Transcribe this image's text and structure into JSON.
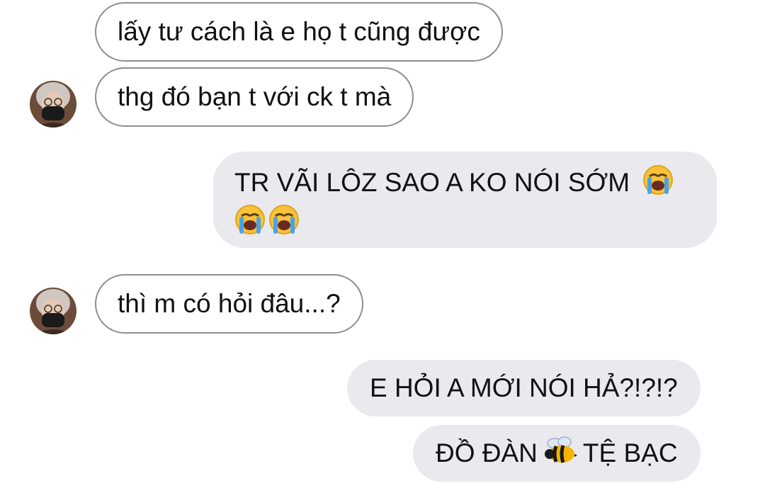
{
  "messages": [
    {
      "side": "incoming",
      "text": "lấy tư cách là e họ t cũng được"
    },
    {
      "side": "incoming",
      "text": "thg đó bạn t với ck t mà"
    },
    {
      "side": "outgoing",
      "text": "TR VÃI LÔZ SAO A KO NÓI SỚM",
      "emoji": [
        "loudly-crying-face",
        "loudly-crying-face",
        "loudly-crying-face"
      ]
    },
    {
      "side": "incoming",
      "text": "thì m có hỏi đâu...?"
    },
    {
      "side": "outgoing",
      "text": "E HỎI A MỚI NÓI HẢ?!?!?"
    },
    {
      "side": "outgoing",
      "text_before": "ĐỒ ĐÀN",
      "emoji": "bee",
      "text_after": "TỆ BẠC"
    }
  ],
  "colors": {
    "incoming_border": "#8e8e93",
    "outgoing_bg": "#e9e9ee",
    "text": "#111111"
  },
  "icons": [
    "avatar",
    "loudly-crying-face-emoji",
    "bee-emoji"
  ]
}
